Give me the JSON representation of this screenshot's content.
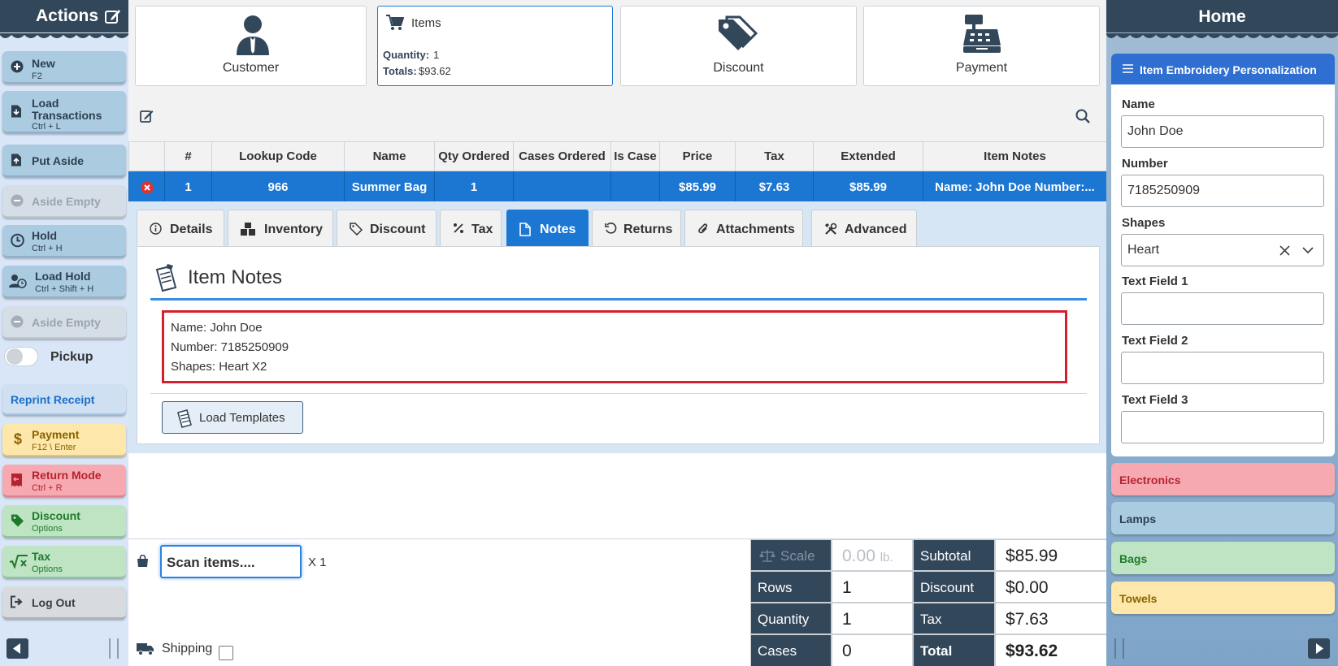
{
  "left": {
    "title": "Actions",
    "buttons": [
      {
        "label": "New",
        "shortcut": "F2"
      },
      {
        "label": "Load Transactions",
        "shortcut": "Ctrl + L"
      },
      {
        "label": "Put Aside"
      },
      {
        "label": "Aside Empty"
      },
      {
        "label": "Hold",
        "shortcut": "Ctrl + H"
      },
      {
        "label": "Load Hold",
        "shortcut": "Ctrl + Shift + H"
      },
      {
        "label": "Aside Empty"
      },
      {
        "label": "Pickup"
      },
      {
        "label": "Reprint Receipt"
      },
      {
        "label": "Payment",
        "shortcut": "F12 \\ Enter"
      },
      {
        "label": "Return Mode",
        "shortcut": "Ctrl + R"
      },
      {
        "label": "Discount",
        "shortcut": "Options"
      },
      {
        "label": "Tax",
        "shortcut": "Options"
      },
      {
        "label": "Log Out"
      }
    ]
  },
  "top": {
    "customer": "Customer",
    "items": {
      "title": "Items",
      "qty_label": "Quantity:",
      "qty": "1",
      "totals_label": "Totals:",
      "totals": "$93.62"
    },
    "discount": "Discount",
    "payment": "Payment"
  },
  "grid": {
    "headers": [
      "#",
      "Lookup Code",
      "Name",
      "Qty Ordered",
      "Cases Ordered",
      "Is Case",
      "Price",
      "Tax",
      "Extended",
      "Item Notes"
    ],
    "row": [
      "1",
      "966",
      "Summer Bag",
      "1",
      "",
      "",
      "$85.99",
      "$7.63",
      "$85.99",
      "Name: John Doe Number:..."
    ]
  },
  "tabs": [
    "Details",
    "Inventory",
    "Discount",
    "Tax",
    "Notes",
    "Returns",
    "Attachments",
    "Advanced"
  ],
  "notes": {
    "title": "Item Notes",
    "lines": [
      "Name: John Doe",
      "Number: 7185250909",
      "Shapes: Heart X2"
    ],
    "load_templates": "Load Templates"
  },
  "bottom": {
    "scan_placeholder": "Scan items....",
    "multiplier": "X 1",
    "shipping": "Shipping"
  },
  "totals": {
    "scale_label": "Scale",
    "scale_value": "0.00",
    "scale_unit": "lb.",
    "rows_label": "Rows",
    "rows": "1",
    "quantity_label": "Quantity",
    "quantity": "1",
    "cases_label": "Cases",
    "cases": "0",
    "subtotal_label": "Subtotal",
    "subtotal": "$85.99",
    "discount_label": "Discount",
    "discount": "$0.00",
    "tax_label": "Tax",
    "tax": "$7.63",
    "total_label": "Total",
    "total": "$93.62"
  },
  "right": {
    "title": "Home",
    "panel": {
      "title": "Item Embroidery Personalization",
      "name_label": "Name",
      "name_value": "John Doe",
      "number_label": "Number",
      "number_value": "7185250909",
      "shapes_label": "Shapes",
      "shapes_value": "Heart",
      "text1_label": "Text Field 1",
      "text2_label": "Text Field 2",
      "text3_label": "Text Field 3"
    },
    "categories": [
      {
        "label": "Electronics",
        "color": "#f7a9b1"
      },
      {
        "label": "Lamps",
        "color": "#aacbe0"
      },
      {
        "label": "Bags",
        "color": "#bfe4c4"
      },
      {
        "label": "Towels",
        "color": "#fde7ab"
      }
    ]
  },
  "colors": {
    "accent": "#1c77d3",
    "header": "#33475b",
    "notes_border": "#d4202c"
  }
}
